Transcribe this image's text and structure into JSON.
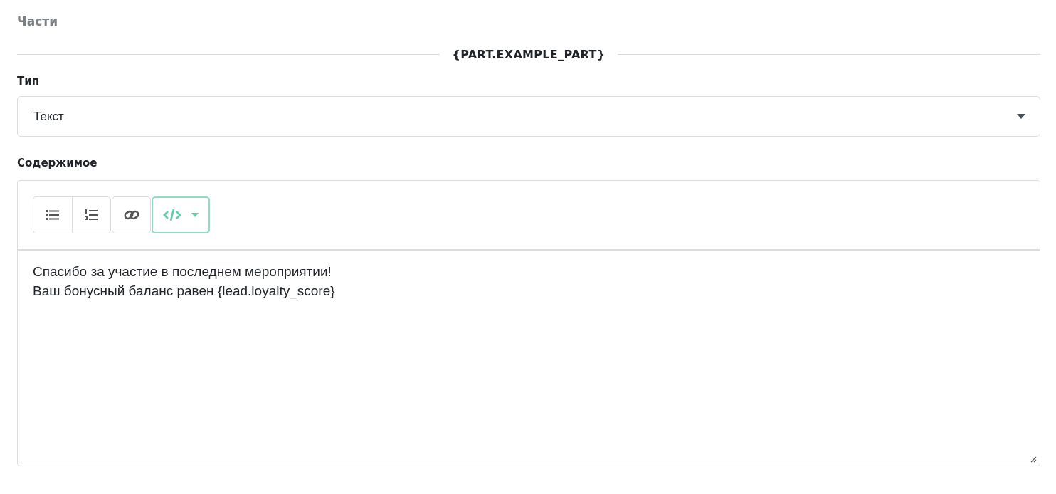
{
  "section_title": "Части",
  "part_divider": {
    "label": "{PART.EXAMPLE_PART}"
  },
  "type_field": {
    "label": "Тип",
    "value": "Текст"
  },
  "content_field": {
    "label": "Содержимое",
    "toolbar": [
      {
        "kind": "bullet-list",
        "selected": false
      },
      {
        "kind": "numbered-list",
        "selected": false
      },
      {
        "kind": "link",
        "selected": false
      },
      {
        "kind": "code",
        "selected": true
      }
    ],
    "lines": [
      "Спасибо за участие в последнем мероприятии!",
      "Ваш бонусный баланс равен {lead.loyalty_score}"
    ]
  }
}
